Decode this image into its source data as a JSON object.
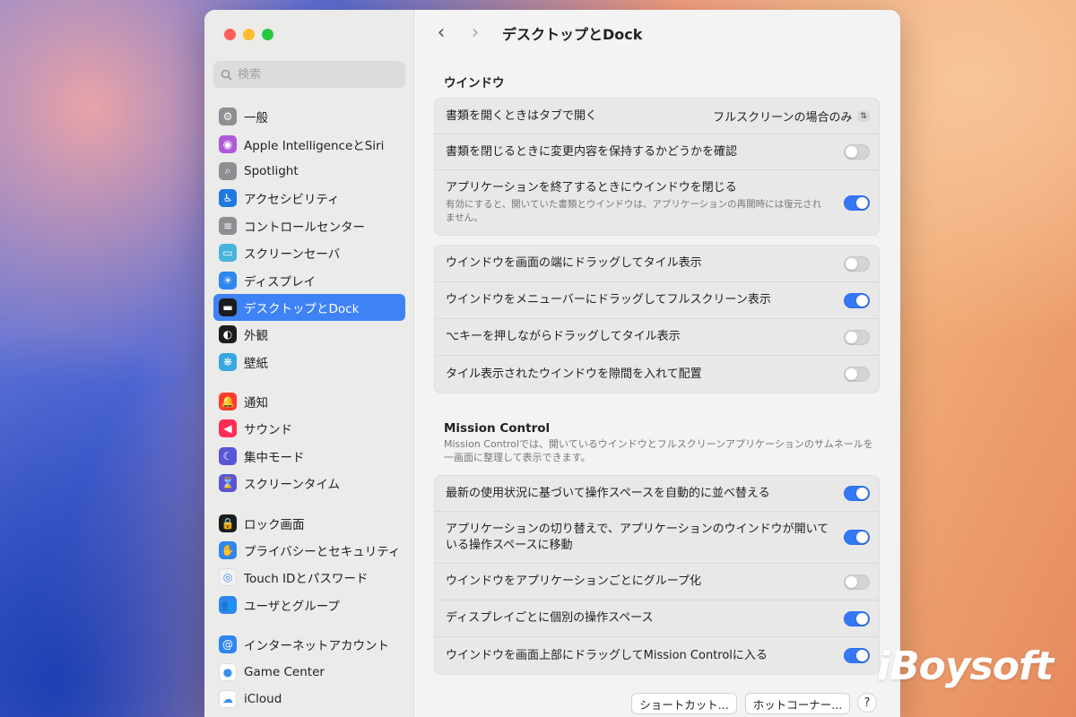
{
  "window": {
    "title": "デスクトップとDock"
  },
  "search": {
    "placeholder": "検索"
  },
  "sidebar": {
    "groups": [
      [
        {
          "label": "一般",
          "icon": "gear-icon"
        },
        {
          "label": "Apple IntelligenceとSiri",
          "icon": "siri-icon"
        },
        {
          "label": "Spotlight",
          "icon": "magnifier-icon"
        },
        {
          "label": "アクセシビリティ",
          "icon": "accessibility-icon"
        },
        {
          "label": "コントロールセンター",
          "icon": "control-center-icon"
        },
        {
          "label": "スクリーンセーバ",
          "icon": "screensaver-icon"
        },
        {
          "label": "ディスプレイ",
          "icon": "sun-icon"
        },
        {
          "label": "デスクトップとDock",
          "icon": "dock-icon"
        },
        {
          "label": "外観",
          "icon": "appearance-icon"
        },
        {
          "label": "壁紙",
          "icon": "wallpaper-icon"
        }
      ],
      [
        {
          "label": "通知",
          "icon": "bell-icon"
        },
        {
          "label": "サウンド",
          "icon": "speaker-icon"
        },
        {
          "label": "集中モード",
          "icon": "moon-icon"
        },
        {
          "label": "スクリーンタイム",
          "icon": "hourglass-icon"
        }
      ],
      [
        {
          "label": "ロック画面",
          "icon": "lock-icon"
        },
        {
          "label": "プライバシーとセキュリティ",
          "icon": "hand-icon"
        },
        {
          "label": "Touch IDとパスワード",
          "icon": "fingerprint-icon"
        },
        {
          "label": "ユーザとグループ",
          "icon": "users-icon"
        }
      ],
      [
        {
          "label": "インターネットアカウント",
          "icon": "at-icon"
        },
        {
          "label": "Game Center",
          "icon": "game-center-icon"
        },
        {
          "label": "iCloud",
          "icon": "cloud-icon"
        }
      ]
    ],
    "active": "デスクトップとDock"
  },
  "windows_section": {
    "title": "ウインドウ",
    "card1": [
      {
        "label": "書類を開くときはタブで開く",
        "select": "フルスクリーンの場合のみ"
      },
      {
        "label": "書類を閉じるときに変更内容を保持するかどうかを確認",
        "on": false
      },
      {
        "label": "アプリケーションを終了するときにウインドウを閉じる",
        "sub": "有効にすると、開いていた書類とウインドウは、アプリケーションの再開時には復元されません。",
        "on": true
      }
    ],
    "card2": [
      {
        "label": "ウインドウを画面の端にドラッグしてタイル表示",
        "on": false
      },
      {
        "label": "ウインドウをメニューバーにドラッグしてフルスクリーン表示",
        "on": true
      },
      {
        "label": "⌥キーを押しながらドラッグしてタイル表示",
        "on": false
      },
      {
        "label": "タイル表示されたウインドウを隙間を入れて配置",
        "on": false
      }
    ]
  },
  "mission_control": {
    "title": "Mission Control",
    "desc": "Mission Controlでは、開いているウインドウとフルスクリーンアプリケーションのサムネールを一画面に整理して表示できます。",
    "rows": [
      {
        "label": "最新の使用状況に基づいて操作スペースを自動的に並べ替える",
        "on": true
      },
      {
        "label": "アプリケーションの切り替えで、アプリケーションのウインドウが開いている操作スペースに移動",
        "on": true
      },
      {
        "label": "ウインドウをアプリケーションごとにグループ化",
        "on": false
      },
      {
        "label": "ディスプレイごとに個別の操作スペース",
        "on": true
      },
      {
        "label": "ウインドウを画面上部にドラッグしてMission Controlに入る",
        "on": true
      }
    ]
  },
  "footer": {
    "shortcuts": "ショートカット...",
    "hot_corners": "ホットコーナー...",
    "help": "?"
  },
  "logo": "iBoysoft",
  "colors": {
    "accent": "#3478f6",
    "selection": "#3f82f5"
  }
}
